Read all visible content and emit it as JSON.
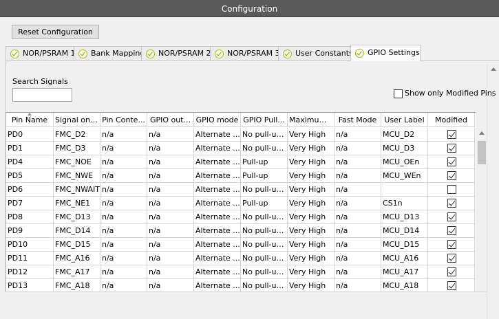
{
  "window": {
    "title": "Configuration"
  },
  "toolbar": {
    "reset_label": "Reset Configuration"
  },
  "tabs": [
    {
      "label": "NOR/PSRAM 1",
      "icon": "check-circle-icon"
    },
    {
      "label": "Bank Mapping",
      "icon": "check-circle-icon"
    },
    {
      "label": "NOR/PSRAM 2",
      "icon": "check-circle-icon"
    },
    {
      "label": "NOR/PSRAM 3",
      "icon": "check-circle-icon"
    },
    {
      "label": "User Constants",
      "icon": "check-circle-icon"
    },
    {
      "label": "GPIO Settings",
      "icon": "check-circle-icon",
      "active": true
    }
  ],
  "search": {
    "label": "Search Signals",
    "value": "",
    "placeholder": ""
  },
  "filter": {
    "show_modified_label": "Show only Modified Pins",
    "checked": false
  },
  "table": {
    "columns": [
      "Pin Name",
      "Signal on ...",
      "Pin Conte...",
      "GPIO out...",
      "GPIO mode",
      "GPIO Pull...",
      "Maximum...",
      "Fast Mode",
      "User Label",
      "Modified"
    ],
    "rows": [
      [
        "PD0",
        "FMC_D2",
        "n/a",
        "n/a",
        "Alternate ...",
        "No pull-up ...",
        "Very High",
        "n/a",
        "MCU_D2",
        true
      ],
      [
        "PD1",
        "FMC_D3",
        "n/a",
        "n/a",
        "Alternate ...",
        "No pull-up ...",
        "Very High",
        "n/a",
        "MCU_D3",
        true
      ],
      [
        "PD4",
        "FMC_NOE",
        "n/a",
        "n/a",
        "Alternate ...",
        "Pull-up",
        "Very High",
        "n/a",
        "MCU_OEn",
        true
      ],
      [
        "PD5",
        "FMC_NWE",
        "n/a",
        "n/a",
        "Alternate ...",
        "Pull-up",
        "Very High",
        "n/a",
        "MCU_WEn",
        true
      ],
      [
        "PD6",
        "FMC_NWAIT",
        "n/a",
        "n/a",
        "Alternate ...",
        "No pull-up ...",
        "Very High",
        "n/a",
        "",
        false
      ],
      [
        "PD7",
        "FMC_NE1",
        "n/a",
        "n/a",
        "Alternate ...",
        "Pull-up",
        "Very High",
        "n/a",
        "CS1n",
        true
      ],
      [
        "PD8",
        "FMC_D13",
        "n/a",
        "n/a",
        "Alternate ...",
        "No pull-up ...",
        "Very High",
        "n/a",
        "MCU_D13",
        true
      ],
      [
        "PD9",
        "FMC_D14",
        "n/a",
        "n/a",
        "Alternate ...",
        "No pull-up ...",
        "Very High",
        "n/a",
        "MCU_D14",
        true
      ],
      [
        "PD10",
        "FMC_D15",
        "n/a",
        "n/a",
        "Alternate ...",
        "No pull-up ...",
        "Very High",
        "n/a",
        "MCU_D15",
        true
      ],
      [
        "PD11",
        "FMC_A16",
        "n/a",
        "n/a",
        "Alternate ...",
        "No pull-up ...",
        "Very High",
        "n/a",
        "MCU_A16",
        true
      ],
      [
        "PD12",
        "FMC_A17",
        "n/a",
        "n/a",
        "Alternate ...",
        "No pull-up ...",
        "Very High",
        "n/a",
        "MCU_A17",
        true
      ],
      [
        "PD13",
        "FMC_A18",
        "n/a",
        "n/a",
        "Alternate ...",
        "No pull-up ...",
        "Very High",
        "n/a",
        "MCU_A18",
        true
      ]
    ]
  }
}
